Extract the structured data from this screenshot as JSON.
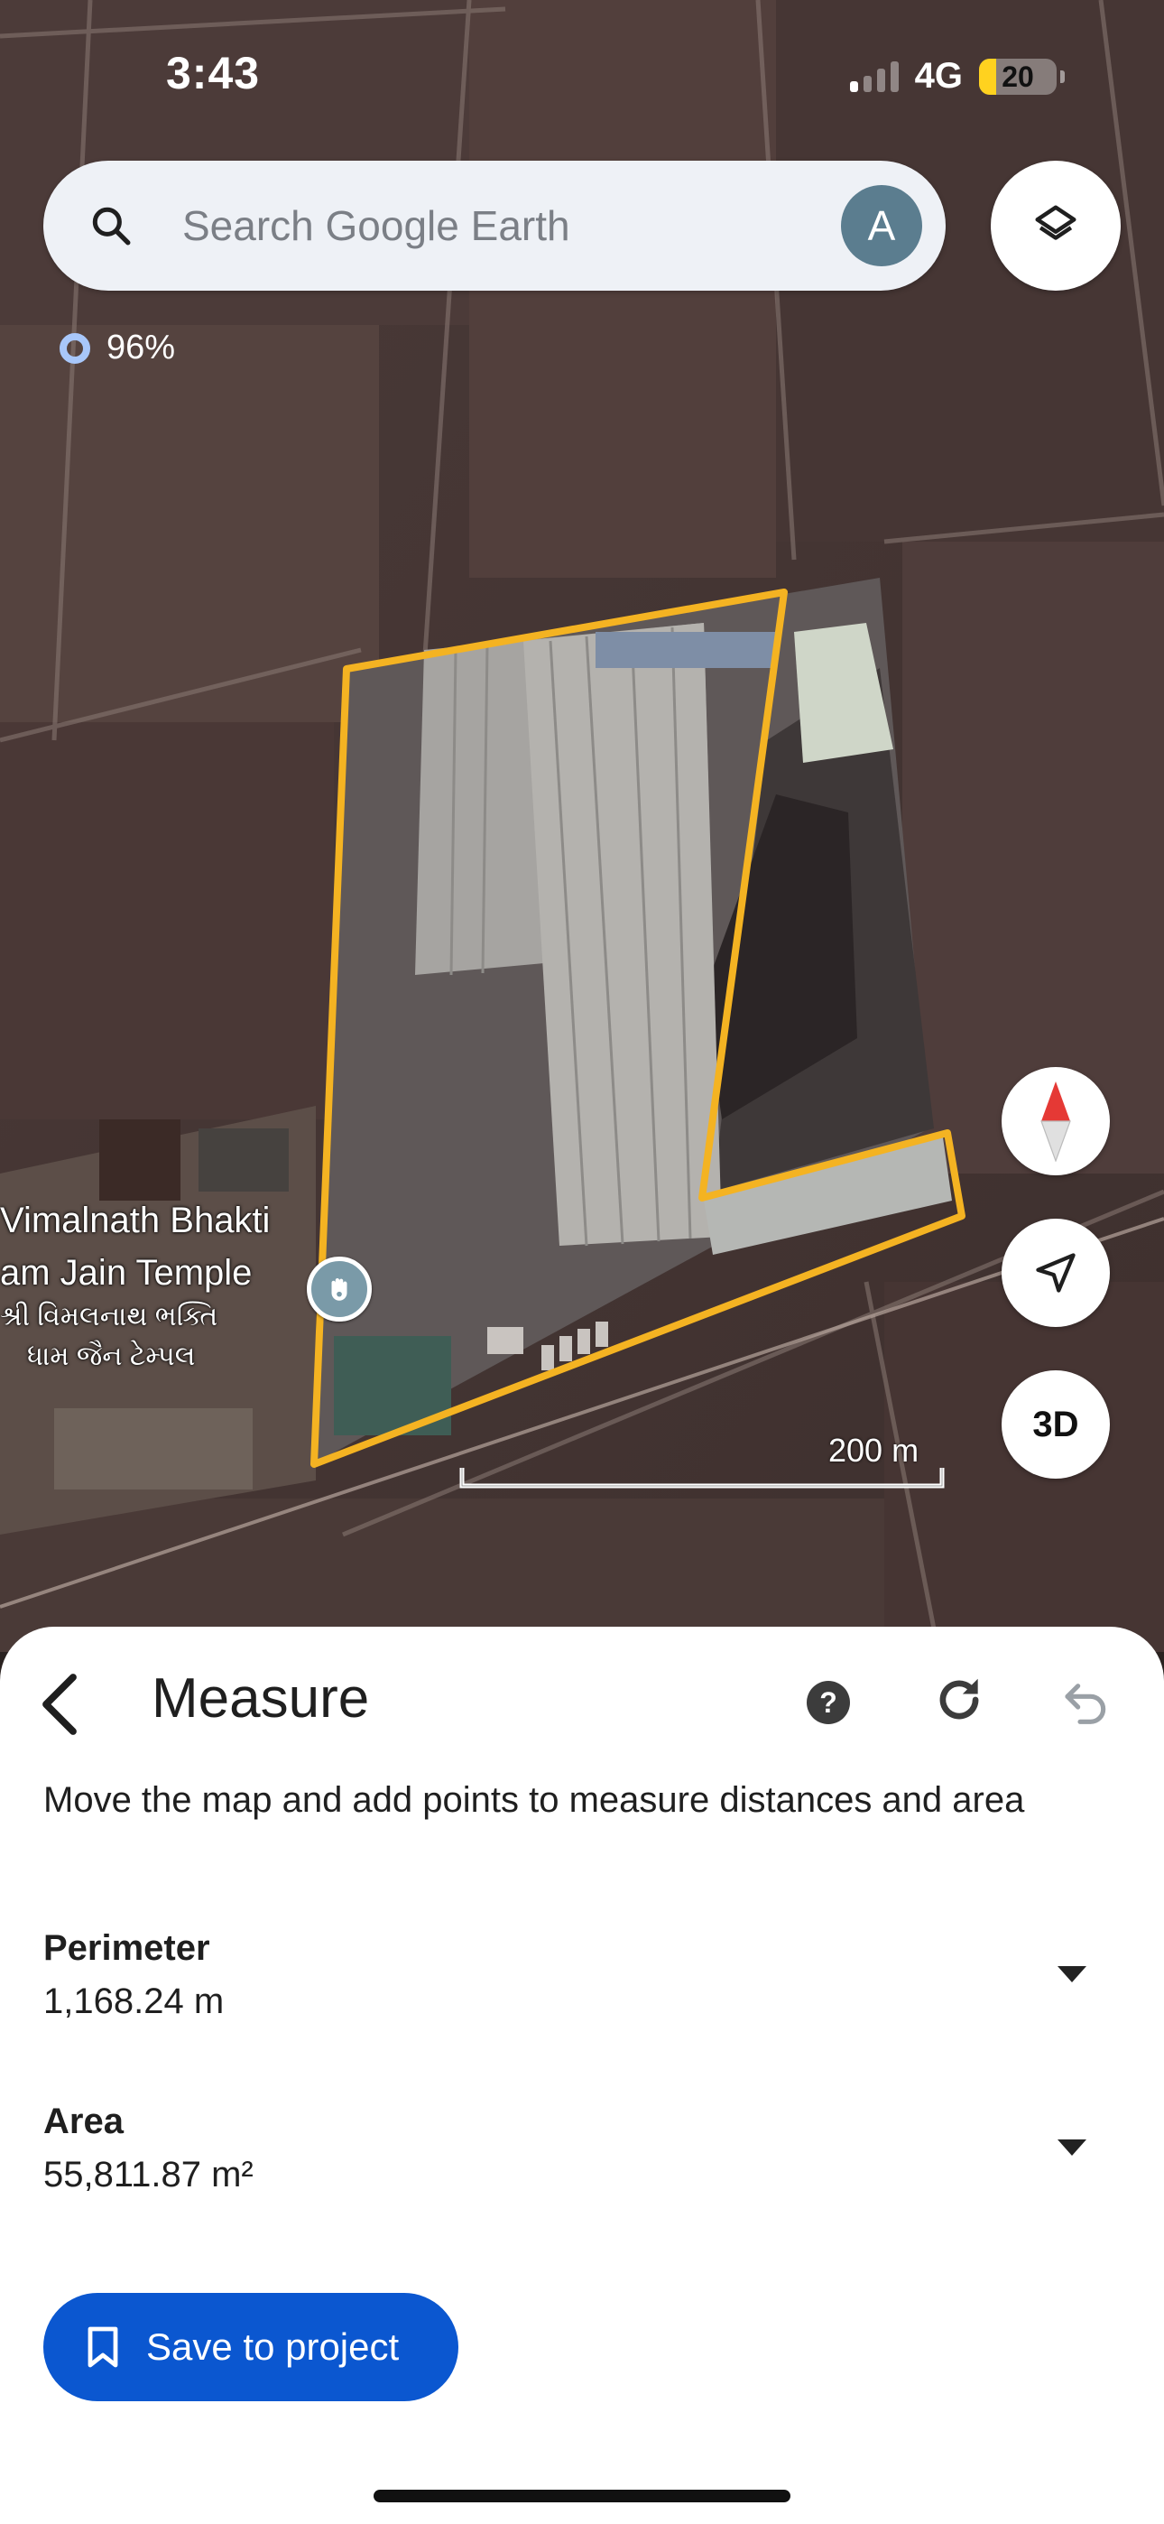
{
  "status_bar": {
    "time": "3:43",
    "network": "4G",
    "battery": "20"
  },
  "search": {
    "placeholder": "Search Google Earth",
    "avatar_initial": "A"
  },
  "loading": {
    "progress_text": "96%"
  },
  "map": {
    "place_label_lines": [
      "Vimalnath Bhakti",
      "am Jain Temple",
      "શ્રી વિમલનાથ ભક્તિ",
      "ધામ જૈન ટેમ્પલ"
    ],
    "scale_label": "200 m",
    "three_d_label": "3D",
    "measure_outline_color": "#f4b322"
  },
  "measure_panel": {
    "title": "Measure",
    "description": "Move the map and add points to measure distances and area",
    "perimeter": {
      "label": "Perimeter",
      "value": "1,168.24 m"
    },
    "area": {
      "label": "Area",
      "value": "55,811.87 m²"
    },
    "save_button": "Save to project",
    "help_symbol": "?"
  },
  "colors": {
    "primary_button": "#0b57d0",
    "measure_outline": "#f4b322"
  }
}
